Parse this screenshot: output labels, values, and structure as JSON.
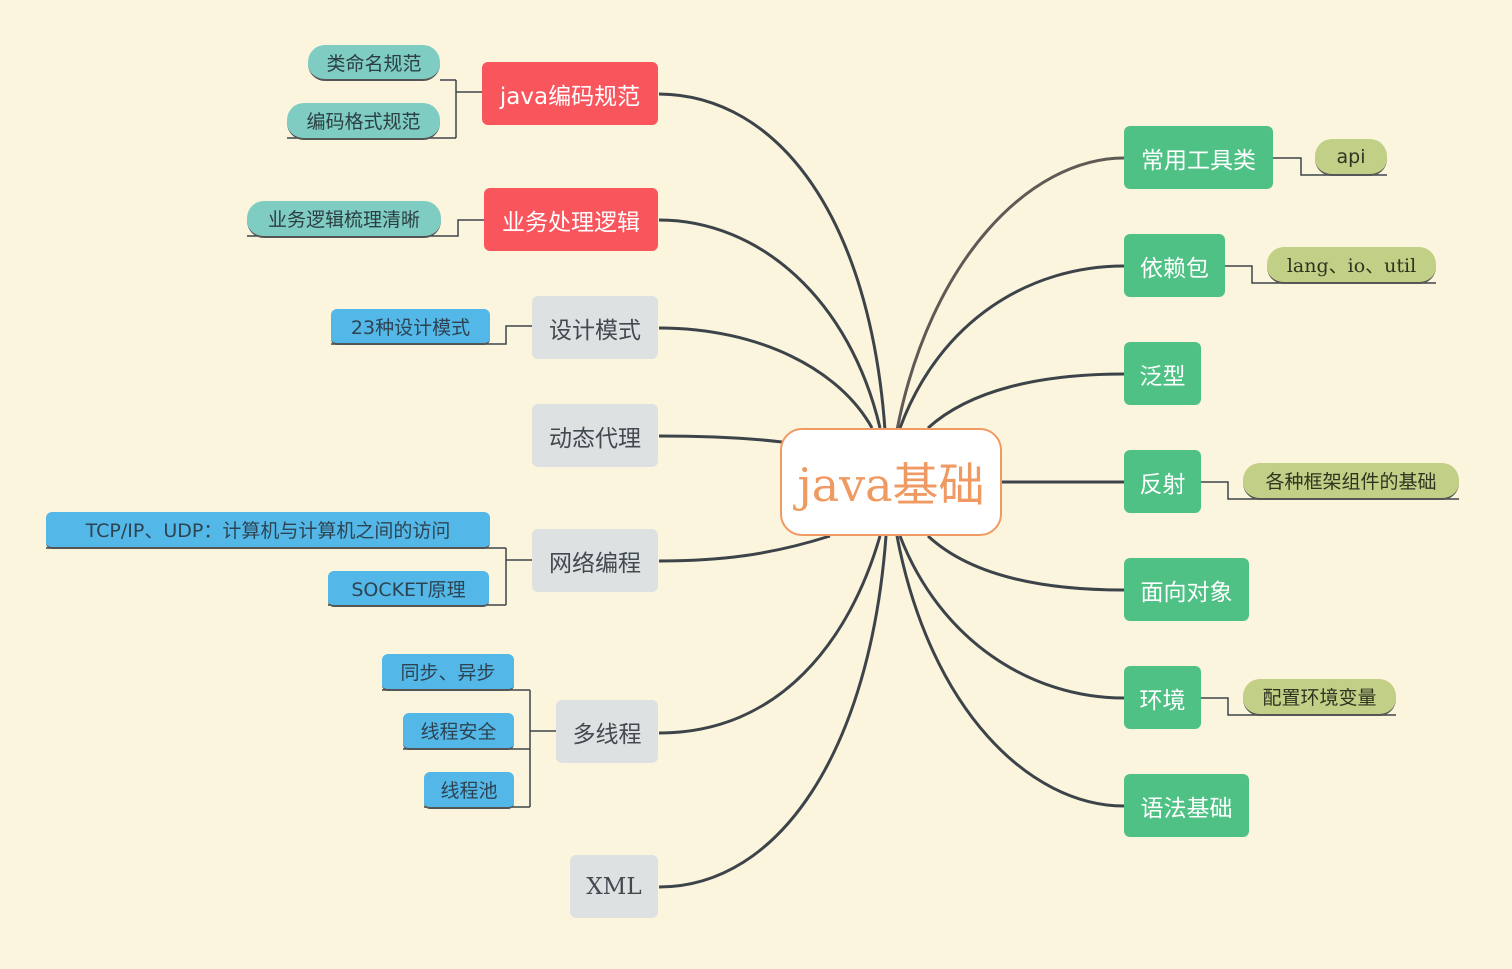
{
  "root": {
    "label": "java基础"
  },
  "left_branches": [
    {
      "label": "java编码规范",
      "children": [
        "类命名规范",
        "编码格式规范"
      ]
    },
    {
      "label": "业务处理逻辑",
      "children": [
        "业务逻辑梳理清晰"
      ]
    },
    {
      "label": "设计模式",
      "children": [
        "23种设计模式"
      ]
    },
    {
      "label": "动态代理",
      "children": []
    },
    {
      "label": "网络编程",
      "children": [
        "TCP/IP、UDP：计算机与计算机之间的访问",
        "SOCKET原理"
      ]
    },
    {
      "label": "多线程",
      "children": [
        "同步、异步",
        "线程安全",
        "线程池"
      ]
    },
    {
      "label": "XML",
      "children": []
    }
  ],
  "right_branches": [
    {
      "label": "常用工具类",
      "children": [
        "api"
      ]
    },
    {
      "label": "依赖包",
      "children": [
        "lang、io、util"
      ]
    },
    {
      "label": "泛型",
      "children": []
    },
    {
      "label": "反射",
      "children": [
        "各种框架组件的基础"
      ]
    },
    {
      "label": "面向对象",
      "children": []
    },
    {
      "label": "环境",
      "children": [
        "配置环境变量"
      ]
    },
    {
      "label": "语法基础",
      "children": []
    }
  ],
  "colors": {
    "background": "#fcf5de",
    "root_border": "#ef9a62",
    "red_branch": "#f9555c",
    "grey_branch": "#dde1e2",
    "green_branch": "#4fc185",
    "teal_sub": "#7fcdc2",
    "blue_sub": "#53b8e8",
    "olive_sub": "#c1cf87",
    "link": "#3d4449"
  }
}
